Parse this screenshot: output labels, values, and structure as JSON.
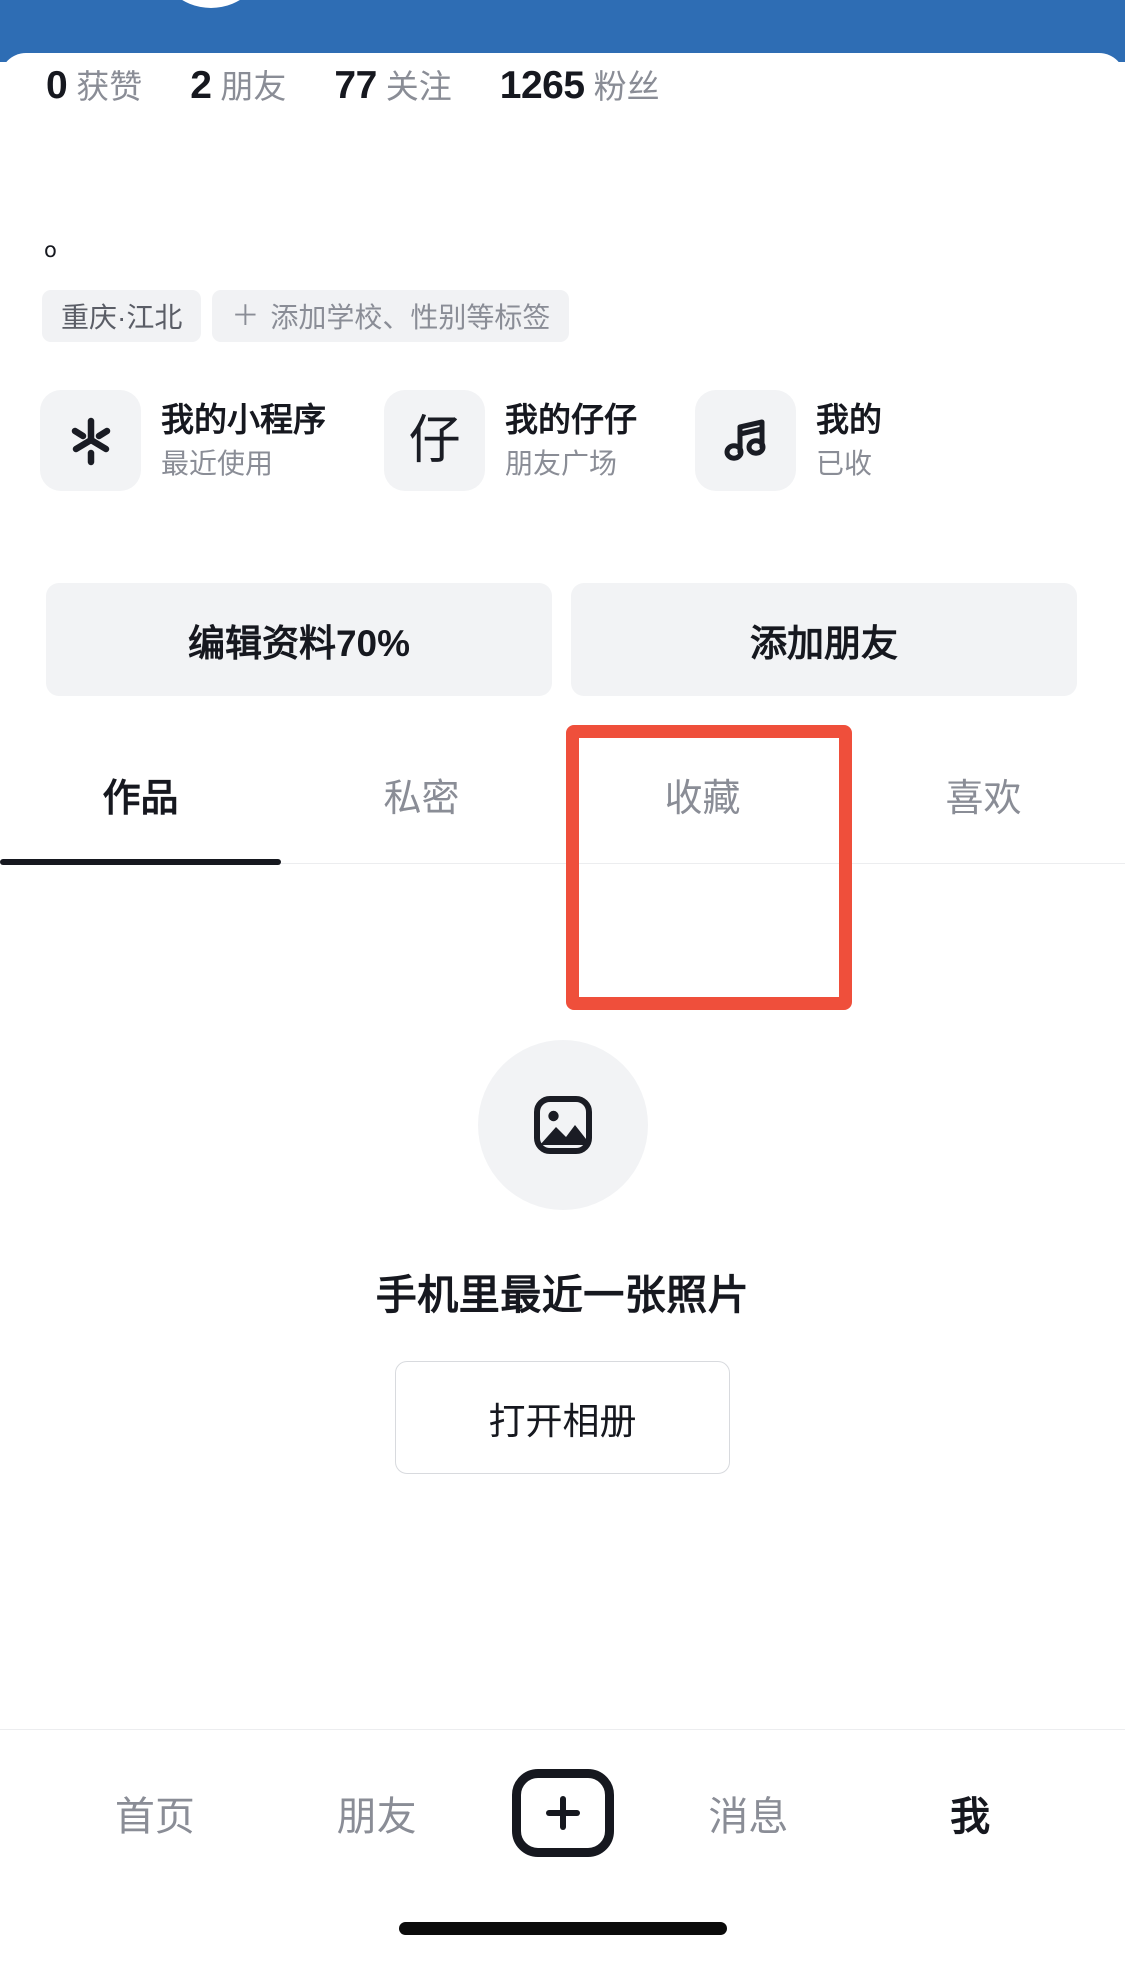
{
  "theme": {
    "header_blue": "#2E6DB4",
    "accent_highlight": "#EF4F3B",
    "text_primary": "#16181F",
    "text_muted": "#8A8D96",
    "chip_bg": "#F1F2F4"
  },
  "profile": {
    "stats": [
      {
        "value": "0",
        "label": "获赞"
      },
      {
        "value": "2",
        "label": "朋友"
      },
      {
        "value": "77",
        "label": "关注"
      },
      {
        "value": "1265",
        "label": "粉丝"
      }
    ],
    "signature": "o",
    "tags": [
      {
        "text": "重庆·江北",
        "has_plus": false
      },
      {
        "text": "添加学校、性别等标签",
        "has_plus": true,
        "plus": "＋"
      }
    ]
  },
  "mini_programs": [
    {
      "icon": "mini-program-star-icon",
      "glyph": "",
      "title": "我的小程序",
      "subtitle": "最近使用"
    },
    {
      "icon": "zaizai-icon",
      "glyph": "仔",
      "title": "我的仔仔",
      "subtitle": "朋友广场"
    },
    {
      "icon": "music-note-icon",
      "glyph": "",
      "title": "我的",
      "subtitle": "已收"
    }
  ],
  "actions": {
    "edit_profile": "编辑资料70%",
    "add_friend": "添加朋友"
  },
  "tabs": [
    {
      "label": "作品",
      "active": true
    },
    {
      "label": "私密",
      "active": false
    },
    {
      "label": "收藏",
      "active": false
    },
    {
      "label": "喜欢",
      "active": false
    }
  ],
  "empty_state": {
    "icon": "photo-image-icon",
    "text": "手机里最近一张照片",
    "button": "打开相册"
  },
  "bottom_nav": {
    "items": [
      {
        "label": "首页",
        "active": false
      },
      {
        "label": "朋友",
        "active": false
      }
    ],
    "create": "+",
    "items_right": [
      {
        "label": "消息",
        "active": false
      },
      {
        "label": "我",
        "active": true
      }
    ]
  }
}
